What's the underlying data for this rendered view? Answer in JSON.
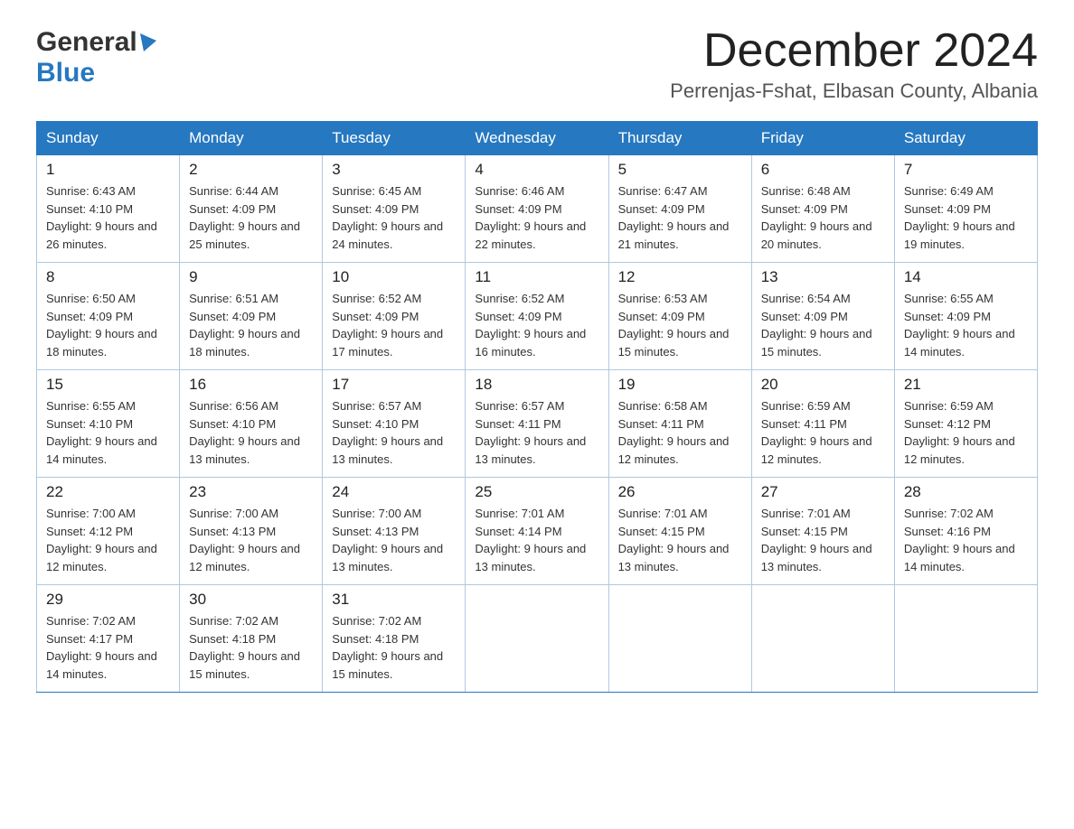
{
  "header": {
    "logo": {
      "general_text": "General",
      "blue_text": "Blue"
    },
    "title": "December 2024",
    "location": "Perrenjas-Fshat, Elbasan County, Albania"
  },
  "calendar": {
    "days_of_week": [
      "Sunday",
      "Monday",
      "Tuesday",
      "Wednesday",
      "Thursday",
      "Friday",
      "Saturday"
    ],
    "weeks": [
      [
        {
          "day": "1",
          "sunrise": "6:43 AM",
          "sunset": "4:10 PM",
          "daylight": "9 hours and 26 minutes."
        },
        {
          "day": "2",
          "sunrise": "6:44 AM",
          "sunset": "4:09 PM",
          "daylight": "9 hours and 25 minutes."
        },
        {
          "day": "3",
          "sunrise": "6:45 AM",
          "sunset": "4:09 PM",
          "daylight": "9 hours and 24 minutes."
        },
        {
          "day": "4",
          "sunrise": "6:46 AM",
          "sunset": "4:09 PM",
          "daylight": "9 hours and 22 minutes."
        },
        {
          "day": "5",
          "sunrise": "6:47 AM",
          "sunset": "4:09 PM",
          "daylight": "9 hours and 21 minutes."
        },
        {
          "day": "6",
          "sunrise": "6:48 AM",
          "sunset": "4:09 PM",
          "daylight": "9 hours and 20 minutes."
        },
        {
          "day": "7",
          "sunrise": "6:49 AM",
          "sunset": "4:09 PM",
          "daylight": "9 hours and 19 minutes."
        }
      ],
      [
        {
          "day": "8",
          "sunrise": "6:50 AM",
          "sunset": "4:09 PM",
          "daylight": "9 hours and 18 minutes."
        },
        {
          "day": "9",
          "sunrise": "6:51 AM",
          "sunset": "4:09 PM",
          "daylight": "9 hours and 18 minutes."
        },
        {
          "day": "10",
          "sunrise": "6:52 AM",
          "sunset": "4:09 PM",
          "daylight": "9 hours and 17 minutes."
        },
        {
          "day": "11",
          "sunrise": "6:52 AM",
          "sunset": "4:09 PM",
          "daylight": "9 hours and 16 minutes."
        },
        {
          "day": "12",
          "sunrise": "6:53 AM",
          "sunset": "4:09 PM",
          "daylight": "9 hours and 15 minutes."
        },
        {
          "day": "13",
          "sunrise": "6:54 AM",
          "sunset": "4:09 PM",
          "daylight": "9 hours and 15 minutes."
        },
        {
          "day": "14",
          "sunrise": "6:55 AM",
          "sunset": "4:09 PM",
          "daylight": "9 hours and 14 minutes."
        }
      ],
      [
        {
          "day": "15",
          "sunrise": "6:55 AM",
          "sunset": "4:10 PM",
          "daylight": "9 hours and 14 minutes."
        },
        {
          "day": "16",
          "sunrise": "6:56 AM",
          "sunset": "4:10 PM",
          "daylight": "9 hours and 13 minutes."
        },
        {
          "day": "17",
          "sunrise": "6:57 AM",
          "sunset": "4:10 PM",
          "daylight": "9 hours and 13 minutes."
        },
        {
          "day": "18",
          "sunrise": "6:57 AM",
          "sunset": "4:11 PM",
          "daylight": "9 hours and 13 minutes."
        },
        {
          "day": "19",
          "sunrise": "6:58 AM",
          "sunset": "4:11 PM",
          "daylight": "9 hours and 12 minutes."
        },
        {
          "day": "20",
          "sunrise": "6:59 AM",
          "sunset": "4:11 PM",
          "daylight": "9 hours and 12 minutes."
        },
        {
          "day": "21",
          "sunrise": "6:59 AM",
          "sunset": "4:12 PM",
          "daylight": "9 hours and 12 minutes."
        }
      ],
      [
        {
          "day": "22",
          "sunrise": "7:00 AM",
          "sunset": "4:12 PM",
          "daylight": "9 hours and 12 minutes."
        },
        {
          "day": "23",
          "sunrise": "7:00 AM",
          "sunset": "4:13 PM",
          "daylight": "9 hours and 12 minutes."
        },
        {
          "day": "24",
          "sunrise": "7:00 AM",
          "sunset": "4:13 PM",
          "daylight": "9 hours and 13 minutes."
        },
        {
          "day": "25",
          "sunrise": "7:01 AM",
          "sunset": "4:14 PM",
          "daylight": "9 hours and 13 minutes."
        },
        {
          "day": "26",
          "sunrise": "7:01 AM",
          "sunset": "4:15 PM",
          "daylight": "9 hours and 13 minutes."
        },
        {
          "day": "27",
          "sunrise": "7:01 AM",
          "sunset": "4:15 PM",
          "daylight": "9 hours and 13 minutes."
        },
        {
          "day": "28",
          "sunrise": "7:02 AM",
          "sunset": "4:16 PM",
          "daylight": "9 hours and 14 minutes."
        }
      ],
      [
        {
          "day": "29",
          "sunrise": "7:02 AM",
          "sunset": "4:17 PM",
          "daylight": "9 hours and 14 minutes."
        },
        {
          "day": "30",
          "sunrise": "7:02 AM",
          "sunset": "4:18 PM",
          "daylight": "9 hours and 15 minutes."
        },
        {
          "day": "31",
          "sunrise": "7:02 AM",
          "sunset": "4:18 PM",
          "daylight": "9 hours and 15 minutes."
        },
        null,
        null,
        null,
        null
      ]
    ]
  }
}
